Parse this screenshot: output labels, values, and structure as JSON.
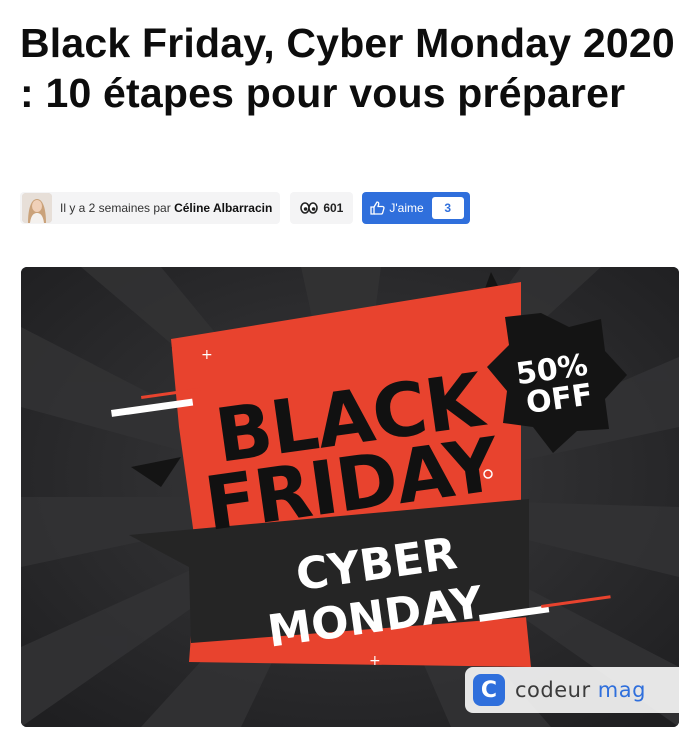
{
  "article": {
    "title": "Black Friday, Cyber Monday 2020 : 10 étapes pour vous préparer"
  },
  "meta": {
    "date_prefix": "Il y a 2 semaines par ",
    "author": "Céline Albarracin",
    "views": "601",
    "like_label": "J'aime",
    "like_count": "3",
    "views_icon": "eyes-icon",
    "like_icon": "thumbs-up-icon"
  },
  "hero": {
    "line1": "BLACK",
    "line2": "FRIDAY",
    "line3": "CYBER",
    "line4": "MONDAY",
    "badge_line1": "50%",
    "badge_line2": "OFF",
    "brand_letter": "C",
    "brand_word1": "codeur",
    "brand_word2": " mag"
  },
  "colors": {
    "accent_blue": "#2f6fdc",
    "promo_red": "#e8432e",
    "background_dark": "#2a2a2c"
  }
}
